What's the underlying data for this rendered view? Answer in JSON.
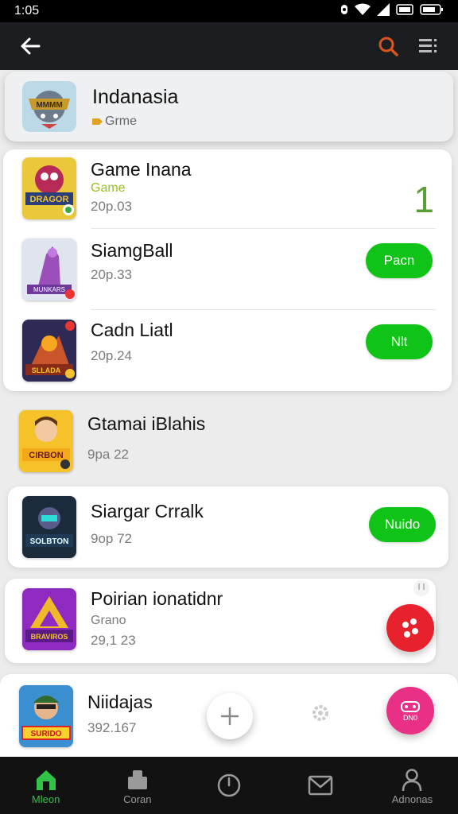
{
  "status_bar": {
    "time": "1:05"
  },
  "featured": {
    "title": "Indanasia",
    "tag": "Grme"
  },
  "apps": [
    {
      "title": "Game Inana",
      "tag": "Game",
      "sub": "20p.03",
      "badge": "1"
    },
    {
      "title": "SiamgBall",
      "sub": "20p.33",
      "action": "Pacn"
    },
    {
      "title": "Cadn Liatl",
      "sub": "20p.24",
      "action": "Nlt"
    },
    {
      "title": "Gtamai iBlahis",
      "sub": "9pa 22"
    },
    {
      "title": "Siargar Crralk",
      "sub": "9op 72",
      "action": "Nuido"
    },
    {
      "title": "Poirian ionatidnr",
      "tag": "Grano",
      "sub": "29,1 23"
    },
    {
      "title": "Niidajas",
      "sub": "392.167"
    }
  ],
  "fab_pink_label": "DN0",
  "bottom_nav": [
    {
      "label": "Mleon",
      "icon": "home-icon",
      "active": true
    },
    {
      "label": "Coran",
      "icon": "store-icon",
      "active": false
    },
    {
      "label": "",
      "icon": "clock-icon",
      "active": false
    },
    {
      "label": "",
      "icon": "mail-icon",
      "active": false
    },
    {
      "label": "Adnonas",
      "icon": "profile-icon",
      "active": false
    }
  ],
  "colors": {
    "accent_green": "#10c417",
    "nav_active": "#32c24a",
    "fab_red": "#e8222d",
    "fab_pink": "#e92f86",
    "header_bg": "#1b1d21"
  }
}
